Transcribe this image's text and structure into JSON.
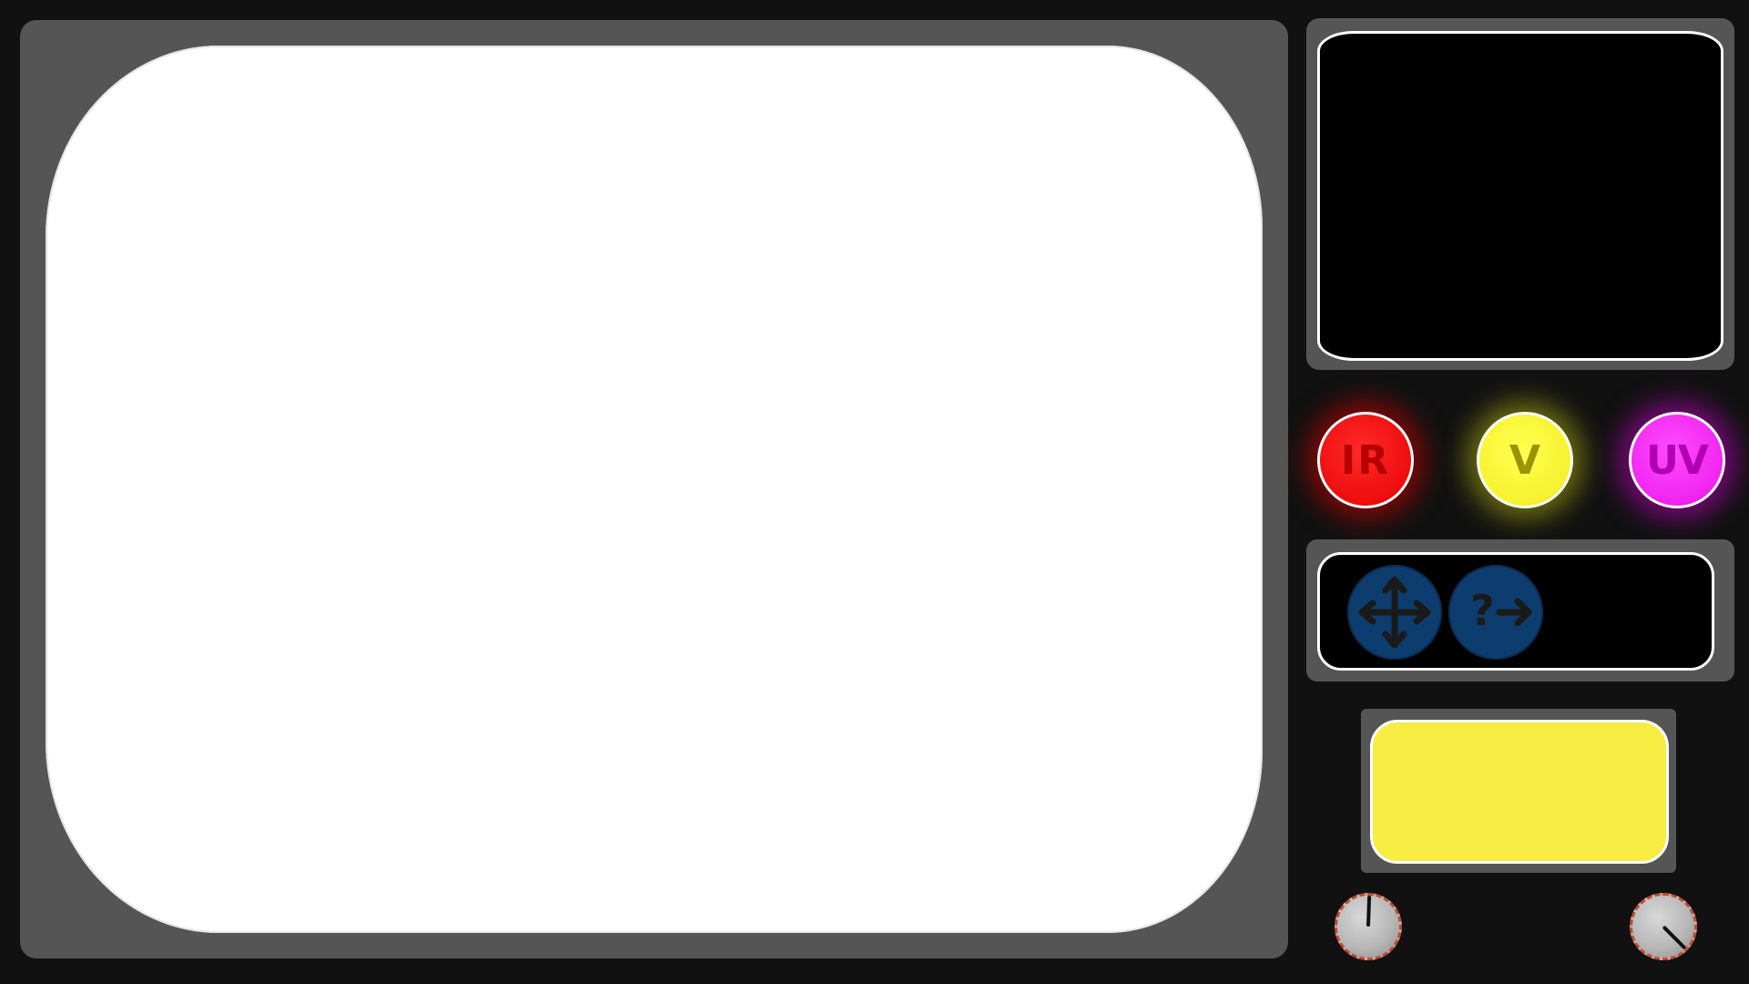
{
  "main_view": {
    "content": ""
  },
  "monitor": {
    "content": ""
  },
  "spectrum_buttons": [
    {
      "label": "IR",
      "color": "#ee0d0d"
    },
    {
      "label": "V",
      "color": "#f6f230"
    },
    {
      "label": "UV",
      "color": "#f025f0"
    }
  ],
  "tools": [
    {
      "icon": "move-arrows-icon",
      "color": "#0d3d6e"
    },
    {
      "icon": "question-arrow-icon",
      "color": "#0d3d6e",
      "glyph": "?"
    }
  ],
  "note_panel": {
    "color": "#f7ec42",
    "text": ""
  },
  "knobs": [
    {
      "name": "left-knob",
      "level": 0.0
    },
    {
      "name": "right-knob",
      "level": 0.75
    }
  ]
}
